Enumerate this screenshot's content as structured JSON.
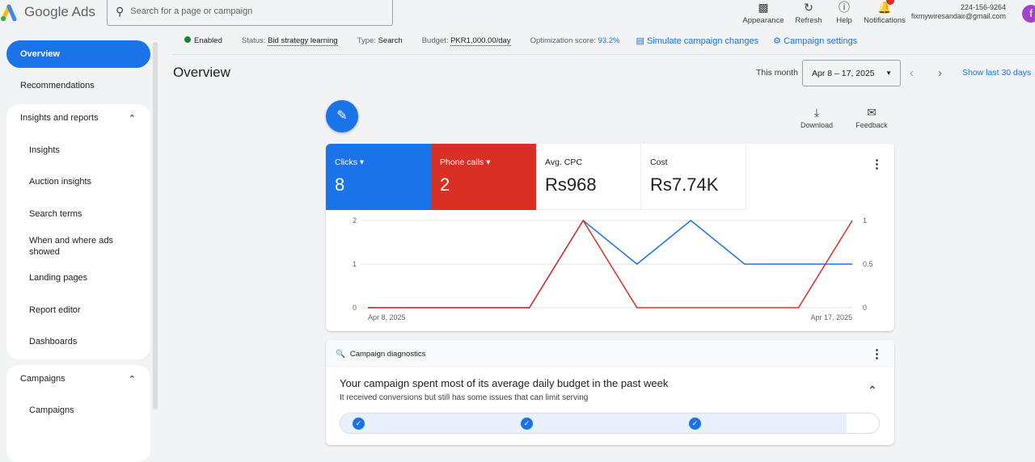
{
  "header": {
    "app_name": "Google Ads",
    "search_placeholder": "Search for a page or campaign",
    "actions": [
      {
        "label": "Appearance",
        "icon": "appearance-icon"
      },
      {
        "label": "Refresh",
        "icon": "refresh-icon"
      },
      {
        "label": "Help",
        "icon": "help-icon"
      },
      {
        "label": "Notifications",
        "icon": "bell-icon"
      }
    ],
    "phone": "224-156-9264",
    "email": "fixmywiresandair@gmail.com",
    "avatar_letter": "f"
  },
  "statusbar": {
    "enabled": "Enabled",
    "status_label": "Status:",
    "status_value": "Bid strategy learning",
    "type_label": "Type:",
    "type_value": "Search",
    "budget_label": "Budget:",
    "budget_value": "PKR1,000.00/day",
    "opt_label": "Optimization score:",
    "opt_value": "93.2%",
    "simulate": "Simulate campaign changes",
    "settings": "Campaign settings"
  },
  "sidebar": {
    "overview": "Overview",
    "recommendations": "Recommendations",
    "insights_group": "Insights and reports",
    "insights_items": [
      "Insights",
      "Auction insights",
      "Search terms",
      "When and where ads showed",
      "Landing pages",
      "Report editor",
      "Dashboards"
    ],
    "campaigns_group": "Campaigns",
    "campaign_items": [
      "Campaigns"
    ]
  },
  "main": {
    "title": "Overview",
    "period_label": "This month",
    "date_range": "Apr 8 – 17, 2025",
    "show_last": "Show last 30 days",
    "download": "Download",
    "feedback": "Feedback",
    "metrics": [
      {
        "label": "Clicks",
        "value": "8",
        "color": "#1a73e8"
      },
      {
        "label": "Phone calls",
        "value": "2",
        "color": "#d93025"
      },
      {
        "label": "Avg. CPC",
        "value": "Rs968"
      },
      {
        "label": "Cost",
        "value": "Rs7.74K"
      }
    ],
    "diagnostics": {
      "header": "Campaign diagnostics",
      "headline": "Your campaign spent most of its average daily budget in the past week",
      "sub": "It received conversions but still has some issues that can limit serving"
    }
  },
  "chart_data": {
    "type": "line",
    "x": [
      "Apr 8",
      "Apr 9",
      "Apr 10",
      "Apr 11",
      "Apr 12",
      "Apr 13",
      "Apr 14",
      "Apr 15",
      "Apr 16",
      "Apr 17"
    ],
    "x_tick_labels": [
      "Apr 8, 2025",
      "Apr 17, 2025"
    ],
    "series": [
      {
        "name": "Clicks",
        "axis": "left",
        "color": "#1a73e8",
        "values": [
          0,
          0,
          0,
          0,
          2,
          1,
          2,
          1,
          1,
          1
        ]
      },
      {
        "name": "Phone calls",
        "axis": "right",
        "color": "#d93025",
        "values": [
          0,
          0,
          0,
          0,
          1,
          0,
          0,
          0,
          0,
          1
        ]
      }
    ],
    "left_ylim": [
      0,
      2
    ],
    "left_ticks": [
      "0",
      "1",
      "2"
    ],
    "right_ylim": [
      0,
      1
    ],
    "right_ticks": [
      "0",
      "0.5",
      "1"
    ],
    "grid": true
  }
}
